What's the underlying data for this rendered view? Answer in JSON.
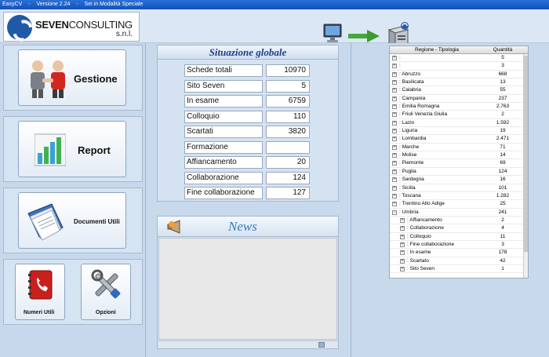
{
  "titlebar": {
    "app": "EasyCV",
    "version": "Versione 2.24",
    "mode": "Sei in Modalità Speciale"
  },
  "logo": {
    "brand_bold": "SEVEN",
    "brand_light": "CONSULTING",
    "suffix": "s.n.l."
  },
  "menu": {
    "gestione": "Gestione",
    "report": "Report",
    "documenti": "Documenti Utili",
    "numeri": "Numeri Utili",
    "opzioni": "Opzioni"
  },
  "situazione": {
    "title": "Situazione   globale",
    "rows": [
      {
        "label": "Schede totali",
        "value": "10970"
      },
      {
        "label": "Sito Seven",
        "value": "5"
      },
      {
        "label": "In esame",
        "value": "6759"
      },
      {
        "label": "Colloquio",
        "value": "110"
      },
      {
        "label": "Scartati",
        "value": "3820"
      },
      {
        "label": "Formazione",
        "value": ""
      },
      {
        "label": "Affiancamento",
        "value": "20"
      },
      {
        "label": "Collaborazione",
        "value": "124"
      },
      {
        "label": "Fine collaborazione",
        "value": "127"
      }
    ]
  },
  "news": {
    "title": "News"
  },
  "tree": {
    "col_region": "Regione - Tipologia",
    "col_qty": "Quantità",
    "rows": [
      {
        "name": ":",
        "qty": "5",
        "level": 0,
        "exp": "+"
      },
      {
        "name": ":",
        "qty": "3",
        "level": 0,
        "exp": "+"
      },
      {
        "name": ": Abruzzo",
        "qty": "668",
        "level": 0,
        "exp": "+"
      },
      {
        "name": ": Basilicata",
        "qty": "13",
        "level": 0,
        "exp": "+"
      },
      {
        "name": ": Calabria",
        "qty": "55",
        "level": 0,
        "exp": "+"
      },
      {
        "name": ": Campania",
        "qty": "237",
        "level": 0,
        "exp": "+"
      },
      {
        "name": ": Emilia Romagna",
        "qty": "2.763",
        "level": 0,
        "exp": "+"
      },
      {
        "name": ": Friuli Venezia Giulia",
        "qty": "2",
        "level": 0,
        "exp": "+"
      },
      {
        "name": ": Lazio",
        "qty": "1.592",
        "level": 0,
        "exp": "+"
      },
      {
        "name": ": Liguria",
        "qty": "19",
        "level": 0,
        "exp": "+"
      },
      {
        "name": ": Lombardia",
        "qty": "2.471",
        "level": 0,
        "exp": "+"
      },
      {
        "name": ": Marche",
        "qty": "71",
        "level": 0,
        "exp": "+"
      },
      {
        "name": ": Molise",
        "qty": "14",
        "level": 0,
        "exp": "+"
      },
      {
        "name": ": Piemonte",
        "qty": "69",
        "level": 0,
        "exp": "+"
      },
      {
        "name": ": Puglia",
        "qty": "124",
        "level": 0,
        "exp": "+"
      },
      {
        "name": ": Sardegna",
        "qty": "16",
        "level": 0,
        "exp": "+"
      },
      {
        "name": ": Sicilia",
        "qty": "101",
        "level": 0,
        "exp": "+"
      },
      {
        "name": ": Toscana",
        "qty": "1.282",
        "level": 0,
        "exp": "+"
      },
      {
        "name": ": Trentino Alto Adige",
        "qty": "25",
        "level": 0,
        "exp": "+"
      },
      {
        "name": ": Umbria",
        "qty": "241",
        "level": 0,
        "exp": "−"
      },
      {
        "name": ": Affiancamento",
        "qty": "2",
        "level": 1,
        "exp": "+"
      },
      {
        "name": ": Collaborazione",
        "qty": "4",
        "level": 1,
        "exp": "+"
      },
      {
        "name": ": Colloquio",
        "qty": "11",
        "level": 1,
        "exp": "+"
      },
      {
        "name": ": Fine collaborazione",
        "qty": "3",
        "level": 1,
        "exp": "+"
      },
      {
        "name": ": In esame",
        "qty": "178",
        "level": 1,
        "exp": "+"
      },
      {
        "name": ": Scartato",
        "qty": "42",
        "level": 1,
        "exp": "+"
      },
      {
        "name": ": Sito Seven",
        "qty": "1",
        "level": 1,
        "exp": "+"
      }
    ]
  }
}
